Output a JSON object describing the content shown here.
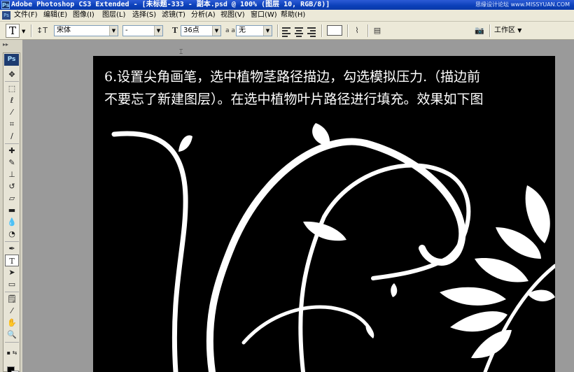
{
  "window": {
    "title": "Adobe Photoshop CS3 Extended - [未标题-333 - 副本.psd @ 100% (图层 10, RGB/8)]",
    "watermark": "思缘设计论坛 www.MISSYUAN.COM",
    "app_icon": "Ps"
  },
  "menu": {
    "items": [
      "文件(F)",
      "编辑(E)",
      "图像(I)",
      "图层(L)",
      "选择(S)",
      "滤镜(T)",
      "分析(A)",
      "视图(V)",
      "窗口(W)",
      "帮助(H)"
    ]
  },
  "options": {
    "tool_glyph": "T",
    "font_family": "宋体",
    "font_style": "-",
    "font_size": "36点",
    "antialias_label": "a a",
    "antialias": "无",
    "workspace": "工作区"
  },
  "tools": {
    "badge": "Ps",
    "list": [
      "move-tool",
      "marquee-tool",
      "lasso-tool",
      "magic-wand-tool",
      "crop-tool",
      "slice-tool",
      "healing-brush-tool",
      "brush-tool",
      "clone-stamp-tool",
      "history-brush-tool",
      "eraser-tool",
      "gradient-tool",
      "blur-tool",
      "dodge-tool",
      "pen-tool",
      "type-tool",
      "path-selection-tool",
      "shape-tool",
      "notes-tool",
      "eyedropper-tool",
      "hand-tool",
      "zoom-tool"
    ]
  },
  "canvas": {
    "caption_lines": [
      "6.设置尖角画笔，选中植物茎路径描边，勾选模拟压力.（描边前",
      "不要忘了新建图层）。在选中植物叶片路径进行填充。效果如下图"
    ],
    "background": "#000000",
    "art_color": "#ffffff"
  },
  "colors": {
    "titlebar": "#0a3fb8",
    "chrome": "#ece9d8",
    "workspace_bg": "#9a9a9a"
  }
}
